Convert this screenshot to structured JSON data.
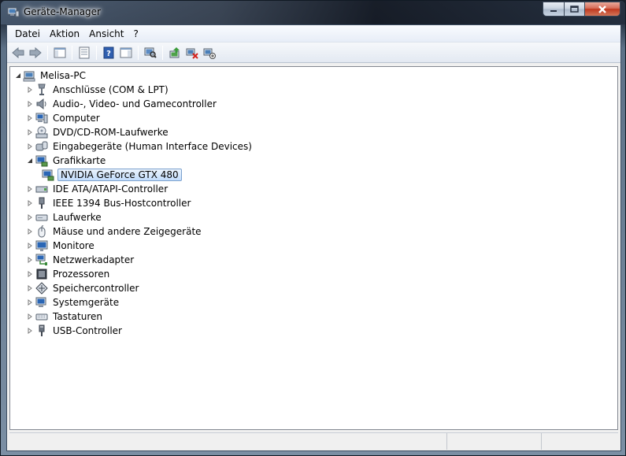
{
  "window": {
    "title": "Geräte-Manager"
  },
  "menu": [
    {
      "label": "Datei"
    },
    {
      "label": "Aktion"
    },
    {
      "label": "Ansicht"
    },
    {
      "label": "?"
    }
  ],
  "toolbar": {
    "buttons": [
      "back-icon",
      "forward-icon",
      "show-hide-console-tree-icon",
      "properties-icon",
      "help-icon",
      "show-hide-action-pane-icon",
      "scan-hardware-icon",
      "update-driver-icon",
      "uninstall-icon",
      "disable-device-icon"
    ]
  },
  "tree": {
    "root": "Melisa-PC",
    "items": [
      {
        "label": "Anschlüsse (COM & LPT)",
        "icon": "port-icon",
        "expanded": false
      },
      {
        "label": "Audio-, Video- und Gamecontroller",
        "icon": "speaker-icon",
        "expanded": false
      },
      {
        "label": "Computer",
        "icon": "computer-icon",
        "expanded": false
      },
      {
        "label": "DVD/CD-ROM-Laufwerke",
        "icon": "dvd-drive-icon",
        "expanded": false
      },
      {
        "label": "Eingabegeräte (Human Interface Devices)",
        "icon": "hid-icon",
        "expanded": false
      },
      {
        "label": "Grafikkarte",
        "icon": "display-adapter-icon",
        "expanded": true,
        "children": [
          {
            "label": "NVIDIA GeForce GTX 480",
            "icon": "display-adapter-icon",
            "selected": true
          }
        ]
      },
      {
        "label": "IDE ATA/ATAPI-Controller",
        "icon": "ide-controller-icon",
        "expanded": false
      },
      {
        "label": "IEEE 1394 Bus-Hostcontroller",
        "icon": "firewire-icon",
        "expanded": false
      },
      {
        "label": "Laufwerke",
        "icon": "disk-drive-icon",
        "expanded": false
      },
      {
        "label": "Mäuse und andere Zeigegeräte",
        "icon": "mouse-icon",
        "expanded": false
      },
      {
        "label": "Monitore",
        "icon": "monitor-icon",
        "expanded": false
      },
      {
        "label": "Netzwerkadapter",
        "icon": "network-adapter-icon",
        "expanded": false
      },
      {
        "label": "Prozessoren",
        "icon": "processor-icon",
        "expanded": false
      },
      {
        "label": "Speichercontroller",
        "icon": "storage-controller-icon",
        "expanded": false
      },
      {
        "label": "Systemgeräte",
        "icon": "system-devices-icon",
        "expanded": false
      },
      {
        "label": "Tastaturen",
        "icon": "keyboard-icon",
        "expanded": false
      },
      {
        "label": "USB-Controller",
        "icon": "usb-icon",
        "expanded": false
      }
    ]
  },
  "colors": {
    "selection_border": "#7da2ce",
    "selection_fill": "#c1dcfc",
    "titlebar_close": "#c0381e"
  }
}
